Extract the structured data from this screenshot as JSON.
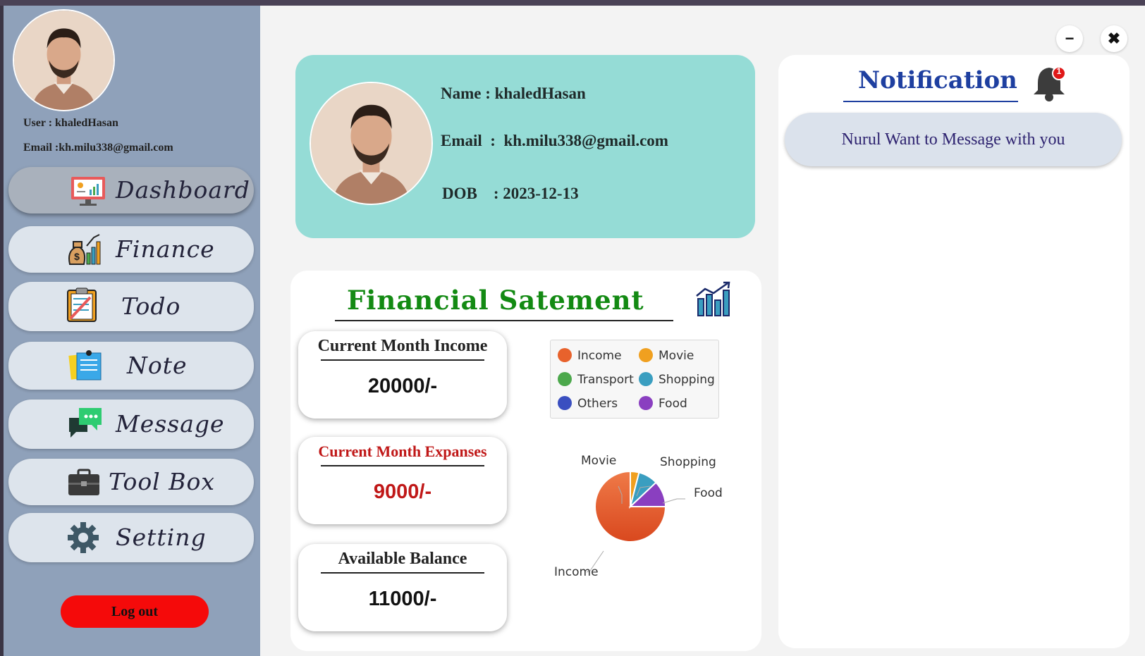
{
  "sidebar": {
    "user_line": "User : khaledHasan",
    "email_line": "Email :kh.milu338@gmail.com",
    "items": [
      {
        "label": "Dashboard",
        "icon": "dashboard-icon"
      },
      {
        "label": "Finance",
        "icon": "finance-icon"
      },
      {
        "label": "Todo",
        "icon": "todo-icon"
      },
      {
        "label": "Note",
        "icon": "note-icon"
      },
      {
        "label": "Message",
        "icon": "message-icon"
      },
      {
        "label": "Tool Box",
        "icon": "toolbox-icon"
      },
      {
        "label": "Setting",
        "icon": "gear-icon"
      }
    ],
    "logout_label": "Log out"
  },
  "window": {
    "minimize": "−",
    "close": "✖"
  },
  "profile": {
    "name_line": "Name : khaledHasan",
    "email_line": "Email  :  kh.milu338@gmail.com",
    "dob_line": "DOB    : 2023-12-13"
  },
  "financial": {
    "title": "Financial Satement",
    "income": {
      "label": "Current Month Income",
      "value": "20000/-"
    },
    "expenses": {
      "label": "Current Month Expanses",
      "value": "9000/-"
    },
    "balance": {
      "label": "Available Balance",
      "value": "11000/-"
    }
  },
  "chart_data": {
    "type": "pie",
    "legend": [
      "Income",
      "Movie",
      "Transport",
      "Shopping",
      "Others",
      "Food"
    ],
    "legend_position": "top-right",
    "labels": [
      "Income",
      "Movie",
      "Shopping",
      "Food"
    ],
    "values": [
      75,
      4,
      9,
      12
    ],
    "colors": {
      "Income": "#e8622c",
      "Movie": "#f0a020",
      "Transport": "#4ca84c",
      "Shopping": "#3a9ec0",
      "Others": "#3a4fc0",
      "Food": "#8a3fc0"
    }
  },
  "notification": {
    "title": "Notification",
    "badge_count": "1",
    "messages": [
      "Nurul Want to Message with you"
    ]
  }
}
